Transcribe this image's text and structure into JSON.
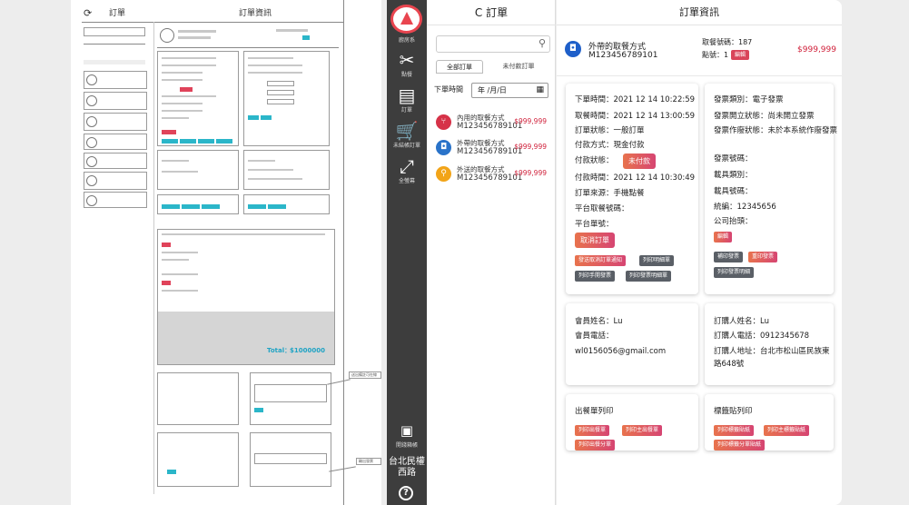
{
  "wireframe": {
    "list_title": "訂單",
    "detail_title": "訂單資訊",
    "total_label": "Total：",
    "total_value": "$1000000",
    "note1": "送出備註可在線",
    "note2": "輸出發票"
  },
  "sidebar": {
    "items": [
      {
        "icon": "dining-icon",
        "label": "點餐"
      },
      {
        "icon": "clipboard-icon",
        "label": "訂單"
      },
      {
        "icon": "cart-icon",
        "label": "未結帳訂單"
      },
      {
        "icon": "expand-icon",
        "label": "全螢幕"
      }
    ],
    "register_label": "開錢箱帳",
    "logo_label": "廚房系",
    "location": "台北民權西路",
    "help": "?"
  },
  "order_list": {
    "title": "訂單",
    "search_placeholder": "",
    "tabs": [
      "全部訂單",
      "未付款訂單"
    ],
    "date_label": "下單時間",
    "date_value": "年 /月/日",
    "orders": [
      {
        "type": "內用的取餐方式",
        "id": "M123456789101",
        "price": "$999,999",
        "color": "#d63248",
        "icon": "fork-knife-icon"
      },
      {
        "type": "外帶的取餐方式",
        "id": "M123456789101",
        "price": "$999,999",
        "color": "#2a73c9",
        "icon": "bag-icon"
      },
      {
        "type": "外送的取餐方式",
        "id": "M123456789101",
        "price": "$999,999",
        "color": "#f2a418",
        "icon": "scooter-icon"
      }
    ]
  },
  "detail": {
    "title": "訂單資訊",
    "summary": {
      "method": "外帶的取餐方式",
      "id": "M123456789101",
      "number": "取餐號碼：187",
      "points": "點號：1",
      "badge": "編輯",
      "price": "$999,999"
    },
    "order_info": {
      "lines": [
        "下單時間：2021 12 14 10:22:59",
        "取餐時間：2021 12 14 13:00:59",
        "訂單狀態：一般訂單",
        "付款方式：現金付款",
        "付款狀態：",
        "付款時間：2021 12 14 10:30:49",
        "訂單來源：手機點餐",
        "平台取餐號碼：",
        "平台單號："
      ],
      "unpaid_label": "未付款",
      "cancel_label": "取消訂單",
      "buttons": [
        "發送取消訂單通知",
        "列印明細單",
        "列印手開發票",
        "列印發票明細單"
      ]
    },
    "invoice_info": {
      "lines": [
        "發票類別：電子發票",
        "發票開立狀態：尚未開立發票",
        "發票作廢狀態：未於本系統作廢發票",
        "發票號碼：",
        "載具類別：",
        "載具號碼：",
        "統編：12345656",
        "公司抬頭："
      ],
      "edit_label": "編輯",
      "buttons": [
        "補印發票",
        "重印發票",
        "列印發票明細"
      ]
    },
    "member": {
      "lines": [
        "會員姓名：Lu",
        "會員電話：",
        "wl0156056@gmail.com"
      ]
    },
    "orderer": {
      "lines": [
        "訂購人姓名：Lu",
        "訂購人電話：0912345678",
        "訂購人地址：台北市松山區民族東",
        "路648號"
      ]
    },
    "print_out": {
      "title": "出餐單列印",
      "buttons": [
        "列印出餐單",
        "列印主出餐單",
        "列印出餐分單"
      ]
    },
    "print_label": {
      "title": "標籤貼列印",
      "buttons": [
        "列印標籤貼紙",
        "列印主標籤貼紙",
        "列印標籤分單貼紙"
      ]
    }
  }
}
